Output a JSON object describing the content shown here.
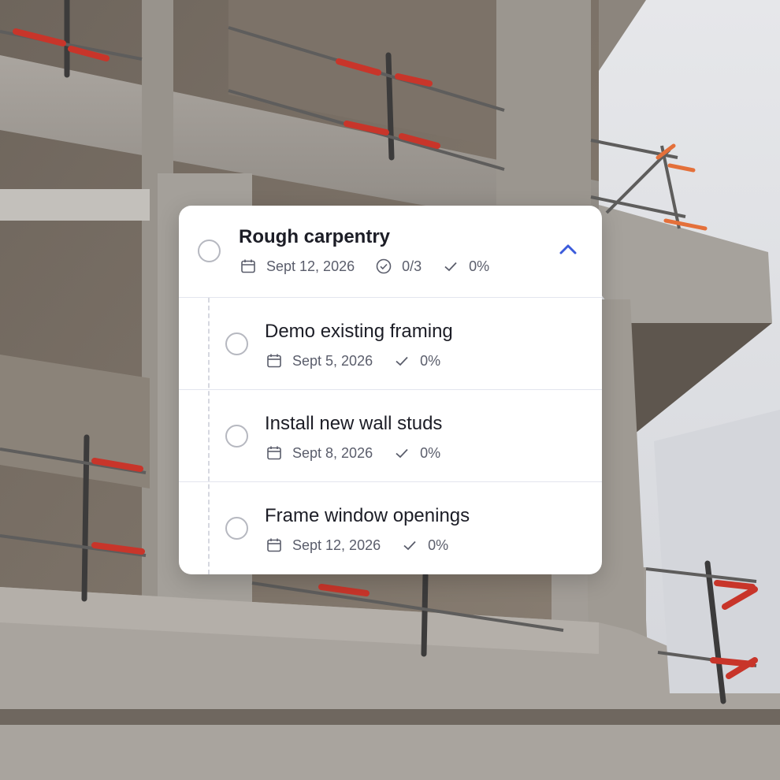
{
  "colors": {
    "accent": "#3b5bdb",
    "sky": "#dfe1e6",
    "concrete": "#9e9a94",
    "rail_red": "#c8352a"
  },
  "parent_task": {
    "title": "Rough carpentry",
    "date": "Sept 12, 2026",
    "subtasks_done": "0/3",
    "progress": "0%",
    "expanded_icon": "chevron-up-icon"
  },
  "subtasks": [
    {
      "title": "Demo existing framing",
      "date": "Sept 5, 2026",
      "progress": "0%"
    },
    {
      "title": "Install new wall studs",
      "date": "Sept 8, 2026",
      "progress": "0%"
    },
    {
      "title": "Frame window openings",
      "date": "Sept 12, 2026",
      "progress": "0%"
    }
  ],
  "icons": {
    "date": "calendar-icon",
    "subtasks": "check-circle-icon",
    "progress": "checkmark-icon"
  }
}
